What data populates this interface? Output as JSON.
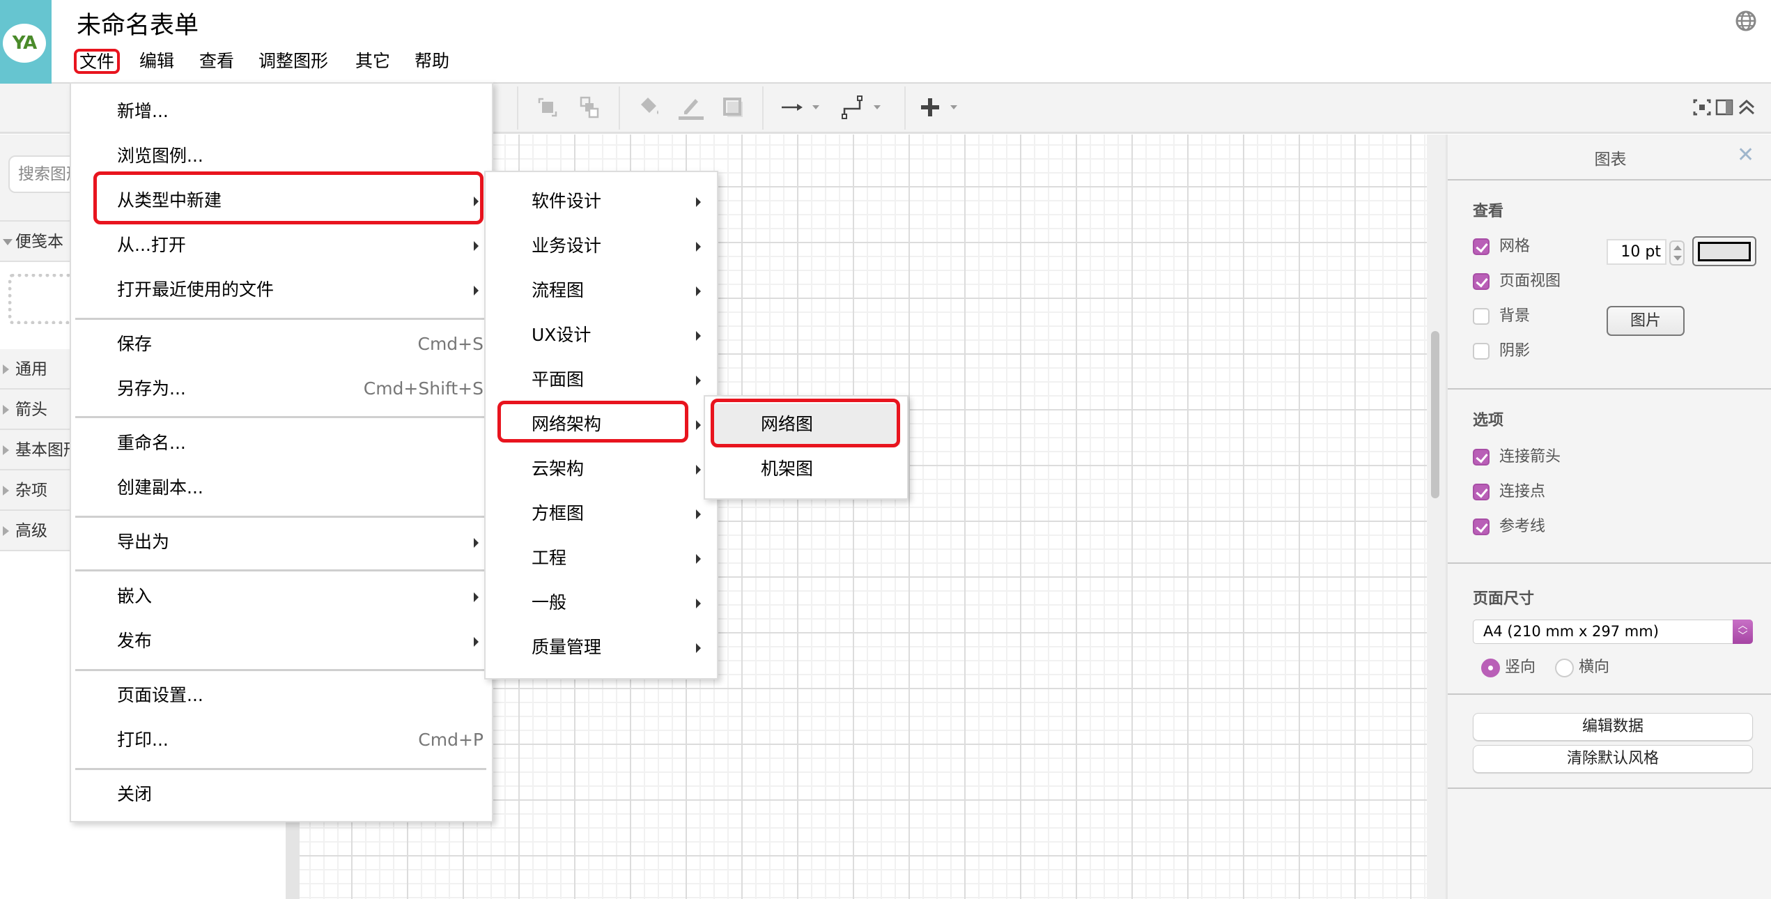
{
  "app": {
    "avatar_initials": "YA",
    "document_title": "未命名表单",
    "accent_color": "#b95fb7",
    "highlight_color": "#e8141e"
  },
  "menubar": {
    "items": [
      {
        "label": "文件",
        "active": true
      },
      {
        "label": "编辑"
      },
      {
        "label": "查看"
      },
      {
        "label": "调整图形"
      },
      {
        "label": "其它"
      },
      {
        "label": "帮助"
      }
    ],
    "language_icon": "globe-icon"
  },
  "toolbar": {
    "icons": [
      "to-front-icon",
      "to-back-icon",
      "fill-color-icon",
      "line-color-icon",
      "shadow-icon",
      "connection-arrow-icon",
      "waypoints-icon",
      "insert-plus-icon"
    ],
    "right_icons": [
      "fullscreen-icon",
      "format-panel-toggle-icon",
      "collapse-icon"
    ]
  },
  "sidebar": {
    "search_placeholder": "搜索图形",
    "sections": [
      {
        "label": "便笺本",
        "expanded": true
      },
      {
        "label": "通用",
        "expanded": false
      },
      {
        "label": "箭头",
        "expanded": false
      },
      {
        "label": "基本图形",
        "expanded": false
      },
      {
        "label": "杂项",
        "expanded": false
      },
      {
        "label": "高级",
        "expanded": false
      }
    ]
  },
  "file_menu": {
    "items": [
      {
        "label": "新增..."
      },
      {
        "label": "浏览图例..."
      },
      {
        "label": "从类型中新建",
        "submenu": true,
        "highlighted": true
      },
      {
        "label": "从...打开",
        "submenu": true
      },
      {
        "label": "打开最近使用的文件",
        "submenu": true
      },
      {
        "label": "保存",
        "shortcut": "Cmd+S"
      },
      {
        "label": "另存为...",
        "shortcut": "Cmd+Shift+S"
      },
      {
        "label": "重命名..."
      },
      {
        "label": "创建副本..."
      },
      {
        "label": "导出为",
        "submenu": true
      },
      {
        "label": "嵌入",
        "submenu": true
      },
      {
        "label": "发布",
        "submenu": true
      },
      {
        "label": "页面设置..."
      },
      {
        "label": "打印...",
        "shortcut": "Cmd+P"
      },
      {
        "label": "关闭"
      }
    ]
  },
  "type_submenu": {
    "items": [
      {
        "label": "软件设计"
      },
      {
        "label": "业务设计"
      },
      {
        "label": "流程图"
      },
      {
        "label": "UX设计"
      },
      {
        "label": "平面图"
      },
      {
        "label": "网络架构",
        "highlighted": true
      },
      {
        "label": "云架构"
      },
      {
        "label": "方框图"
      },
      {
        "label": "工程"
      },
      {
        "label": "一般"
      },
      {
        "label": "质量管理"
      }
    ]
  },
  "network_submenu": {
    "items": [
      {
        "label": "网络图",
        "highlighted": true,
        "hovered": true
      },
      {
        "label": "机架图"
      }
    ]
  },
  "format_panel": {
    "title": "图表",
    "view": {
      "heading": "查看",
      "grid": {
        "label": "网格",
        "checked": true,
        "size": "10 pt",
        "color": "#e4e4e4"
      },
      "page_view": {
        "label": "页面视图",
        "checked": true
      },
      "background": {
        "label": "背景",
        "checked": false,
        "button": "图片"
      },
      "shadow": {
        "label": "阴影",
        "checked": false
      }
    },
    "options": {
      "heading": "选项",
      "connection_arrows": {
        "label": "连接箭头",
        "checked": true
      },
      "connection_points": {
        "label": "连接点",
        "checked": true
      },
      "guides": {
        "label": "参考线",
        "checked": true
      }
    },
    "page_size": {
      "heading": "页面尺寸",
      "selected": "A4 (210 mm x 297 mm)",
      "orientation": {
        "portrait": "竖向",
        "landscape": "横向",
        "selected": "portrait"
      }
    },
    "buttons": {
      "edit_data": "编辑数据",
      "clear_default_style": "清除默认风格"
    }
  }
}
